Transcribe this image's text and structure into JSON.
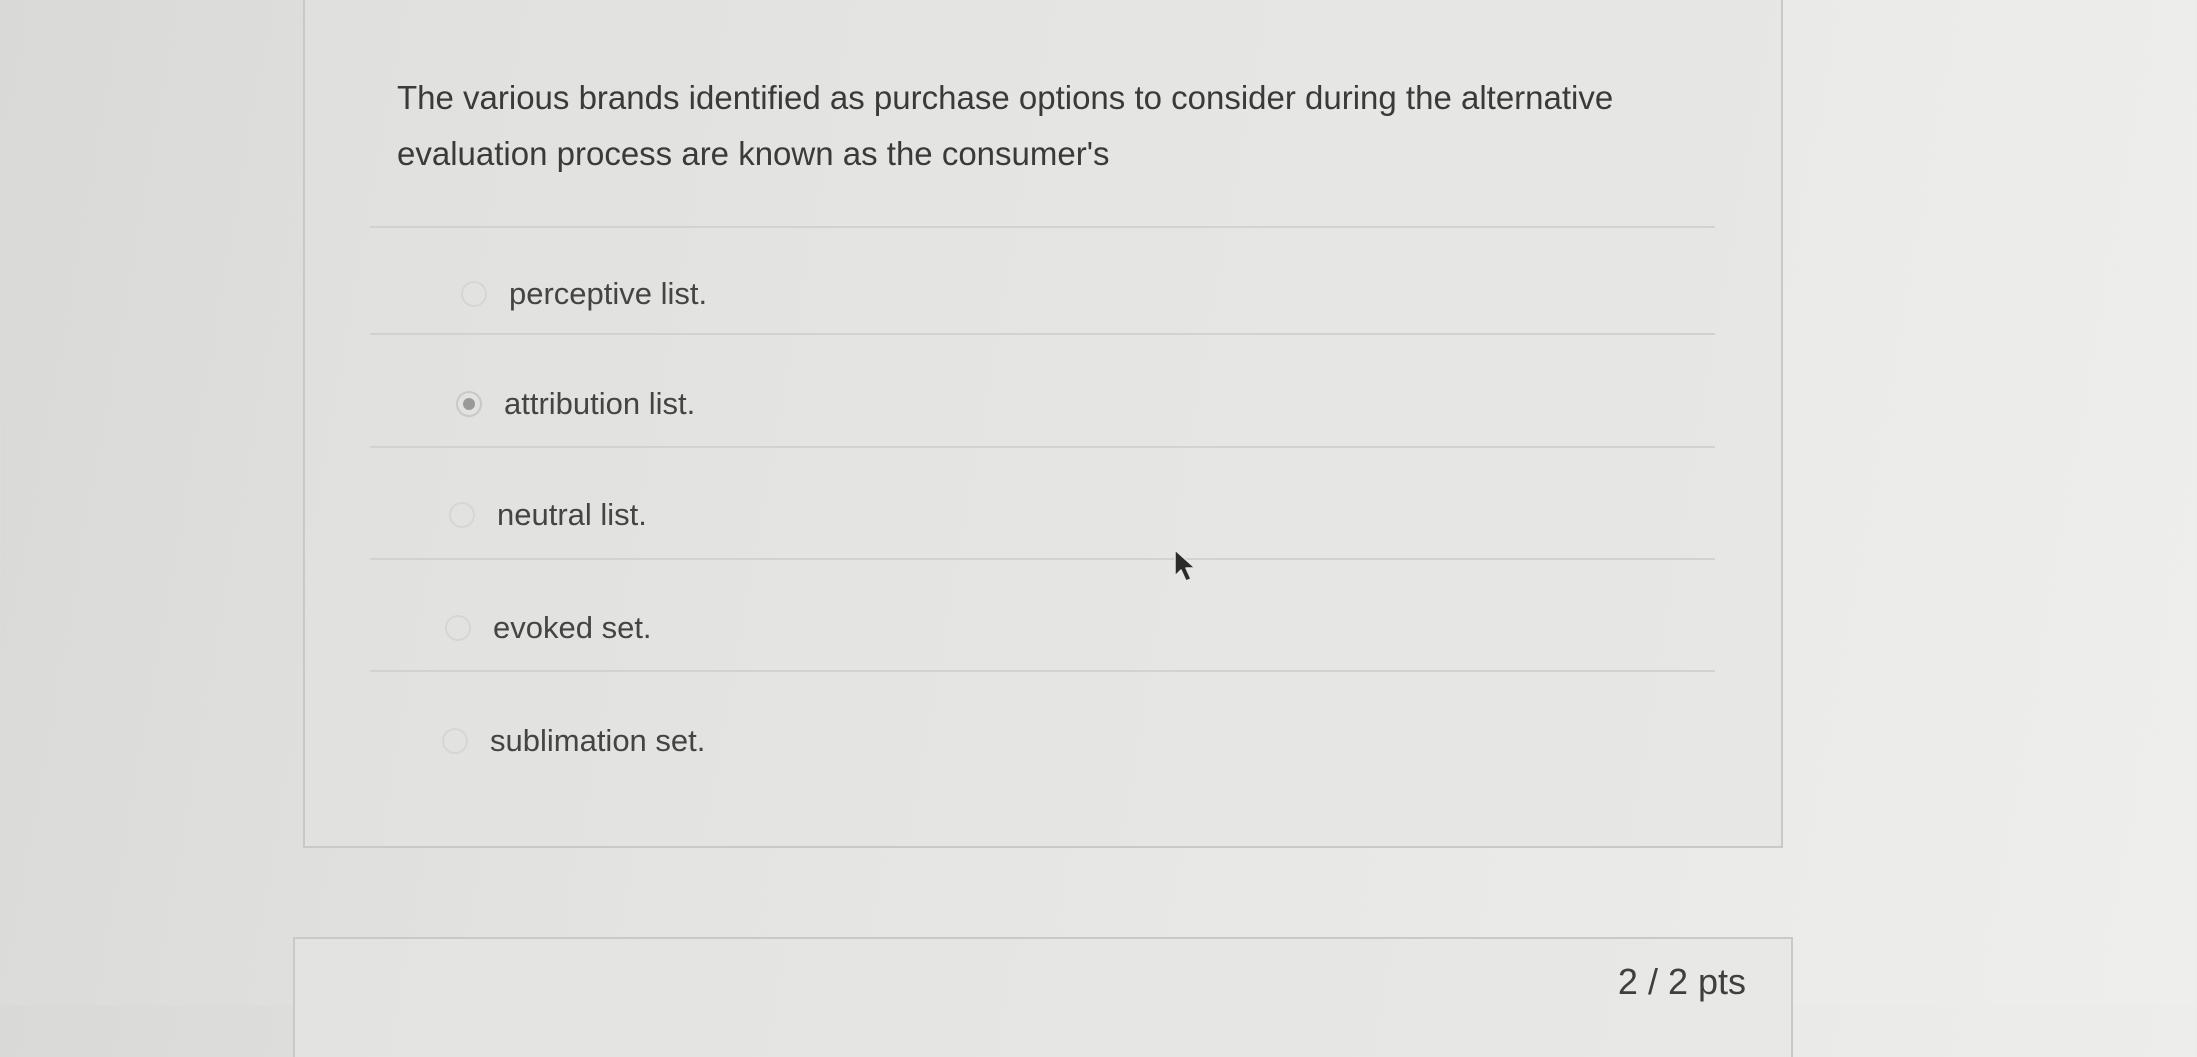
{
  "question": {
    "text": "The various brands identified as purchase options to consider during the alternative evaluation process are known as the consumer's"
  },
  "options": [
    {
      "label": "perceptive list.",
      "selected": false
    },
    {
      "label": "attribution list.",
      "selected": true
    },
    {
      "label": "neutral list.",
      "selected": false
    },
    {
      "label": "evoked set.",
      "selected": false
    },
    {
      "label": "sublimation set.",
      "selected": false
    }
  ],
  "next_question": {
    "points": "2 / 2 pts"
  },
  "icons": {
    "radio": "radio-button-icon",
    "cursor": "mouse-pointer-icon"
  }
}
